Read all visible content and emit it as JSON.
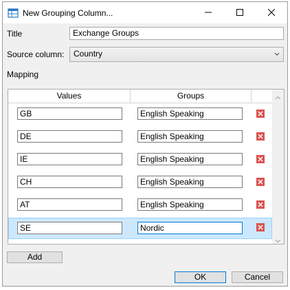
{
  "window": {
    "title": "New Grouping Column..."
  },
  "form": {
    "title_label": "Title",
    "title_value": "Exchange Groups",
    "source_label": "Source column:",
    "source_value": "Country",
    "mapping_label": "Mapping"
  },
  "grid": {
    "headers": [
      "Values",
      "Groups"
    ],
    "rows": [
      {
        "value": "GB",
        "group": "English Speaking"
      },
      {
        "value": "DE",
        "group": "English Speaking"
      },
      {
        "value": "IE",
        "group": "English Speaking"
      },
      {
        "value": "CH",
        "group": "English Speaking"
      },
      {
        "value": "AT",
        "group": "English Speaking"
      },
      {
        "value": "SE",
        "group": "Nordic"
      }
    ],
    "selected_row": 5
  },
  "buttons": {
    "add": "Add",
    "ok": "OK",
    "cancel": "Cancel"
  },
  "icons": {
    "app": "grid-window-icon",
    "delete": "delete-x-icon",
    "minimize": "minimize-icon",
    "maximize": "maximize-icon",
    "close": "close-icon"
  },
  "colors": {
    "accent": "#0078d7",
    "delete": "#d9534f",
    "selection": "#cce8ff"
  }
}
